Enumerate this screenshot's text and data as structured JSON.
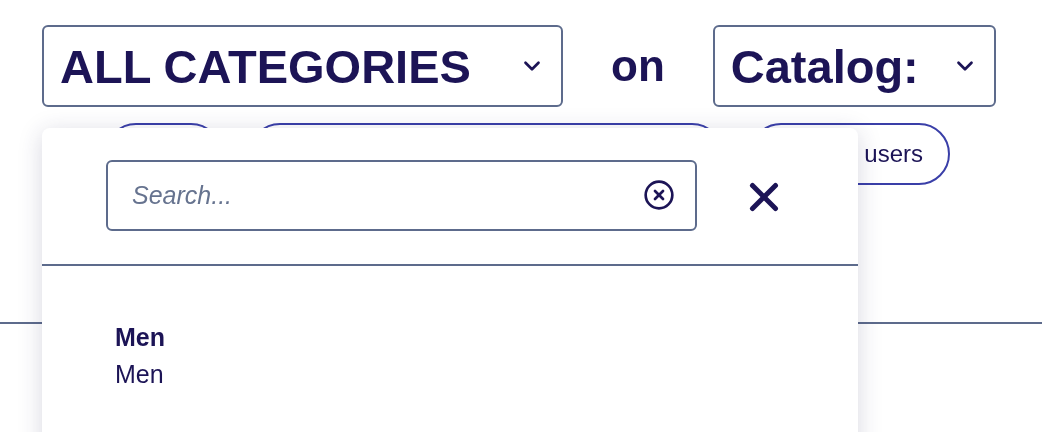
{
  "category_select": {
    "value": "ALL CATEGORIES"
  },
  "connector": "on",
  "catalog_select": {
    "value": "Catalog:"
  },
  "chips": [
    {
      "kind": "covered"
    },
    {
      "kind": "covered"
    },
    {
      "kind": "text",
      "label": "users"
    }
  ],
  "dropdown": {
    "search": {
      "placeholder": "Search..."
    },
    "options": [
      {
        "title": "Men",
        "subtitle": "Men"
      }
    ]
  }
}
